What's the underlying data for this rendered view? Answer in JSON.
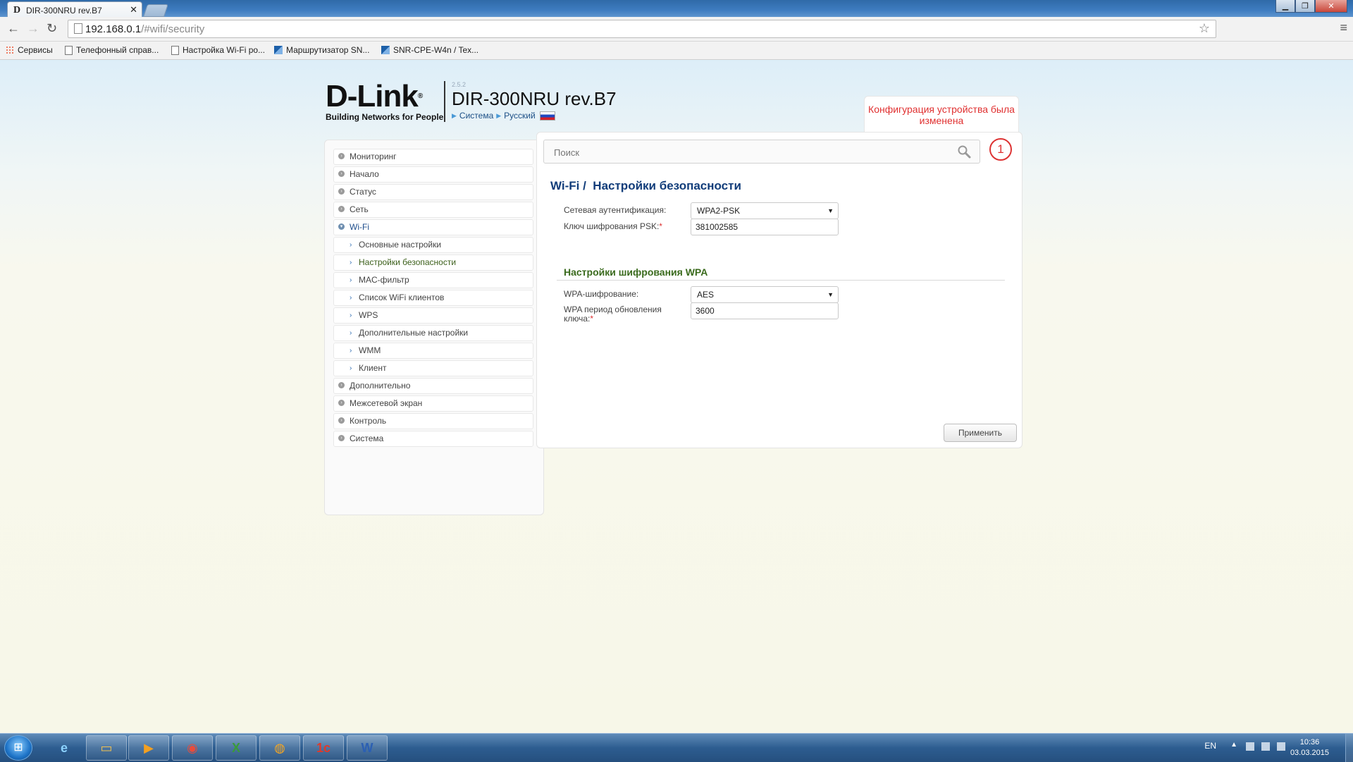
{
  "browser": {
    "tab_title": "DIR-300NRU rev.B7",
    "tab_favicon": "D",
    "tab_close": "✕",
    "url_host": "192.168.0.1",
    "url_path": "/#wifi/security",
    "window_controls": [
      "▁",
      "❐",
      "✕"
    ],
    "bookmarks": [
      {
        "label": "Сервисы",
        "icon": "apps-icon"
      },
      {
        "label": "Телефонный справ...",
        "icon": "page-icon"
      },
      {
        "label": "Настройка Wi-Fi ро...",
        "icon": "page-icon"
      },
      {
        "label": "Маршрутизатор SN...",
        "icon": "router-icon"
      },
      {
        "label": "SNR-CPE-W4n / Tex...",
        "icon": "router-icon"
      }
    ]
  },
  "header": {
    "brand": "D-Link",
    "reg_mark": "®",
    "tagline": "Building Networks for People",
    "firmware": "2.5.2",
    "model": "DIR-300NRU rev.B7",
    "crumb_system": "Система",
    "crumb_language": "Русский"
  },
  "notification": {
    "text": "Конфигурация устройства была изменена",
    "count": "1"
  },
  "menu": [
    {
      "label": "Мониторинг",
      "level": 0
    },
    {
      "label": "Начало",
      "level": 0
    },
    {
      "label": "Статус",
      "level": 0
    },
    {
      "label": "Сеть",
      "level": 0
    },
    {
      "label": "Wi-Fi",
      "level": 0,
      "open": true
    },
    {
      "label": "Основные настройки",
      "level": 1
    },
    {
      "label": "Настройки безопасности",
      "level": 1,
      "active": true
    },
    {
      "label": "MAC-фильтр",
      "level": 1
    },
    {
      "label": "Список WiFi клиентов",
      "level": 1
    },
    {
      "label": "WPS",
      "level": 1
    },
    {
      "label": "Дополнительные настройки",
      "level": 1
    },
    {
      "label": "WMM",
      "level": 1
    },
    {
      "label": "Клиент",
      "level": 1
    },
    {
      "label": "Дополнительно",
      "level": 0
    },
    {
      "label": "Межсетевой экран",
      "level": 0
    },
    {
      "label": "Контроль",
      "level": 0
    },
    {
      "label": "Система",
      "level": 0
    }
  ],
  "content": {
    "search_placeholder": "Поиск",
    "title_section": "Wi-Fi /",
    "title_page": "Настройки безопасности",
    "auth_label": "Сетевая аутентификация:",
    "auth_value": "WPA2-PSK",
    "psk_label": "Ключ шифрования PSK:",
    "psk_value": "381002585",
    "wpa_section": "Настройки шифрования WPA",
    "wpa_enc_label": "WPA-шифрование:",
    "wpa_enc_value": "AES",
    "wpa_period_label_1": "WPA период обновления",
    "wpa_period_label_2": "ключа:",
    "wpa_period_value": "3600",
    "required_mark": "*",
    "apply_label": "Применить"
  },
  "taskbar": {
    "apps": [
      "ie-icon",
      "explorer-icon",
      "media-player-icon",
      "chrome-icon",
      "excel-icon",
      "media-icon",
      "1c-icon",
      "word-icon"
    ],
    "lang": "EN",
    "time": "10:36",
    "date": "03.03.2015"
  }
}
